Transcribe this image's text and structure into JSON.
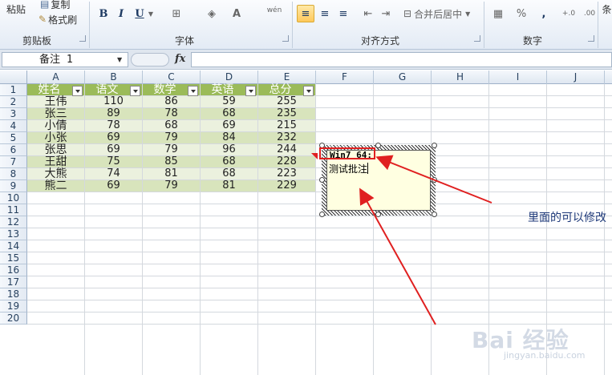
{
  "ribbon": {
    "clipboard": {
      "paste": "粘贴",
      "copy": "复制",
      "format_painter": "格式刷",
      "label": "剪贴板"
    },
    "font": {
      "bold": "B",
      "italic": "I",
      "underline": "U",
      "font_color": "A",
      "wen": "wén",
      "label": "字体"
    },
    "alignment": {
      "merge_center": "合并后居中",
      "label": "对齐方式"
    },
    "number": {
      "percent": "%",
      "comma": ",",
      "label": "数字"
    },
    "cut_off": "条"
  },
  "formula_bar": {
    "name_box": "备注 1",
    "fx": "fx",
    "formula": ""
  },
  "grid": {
    "columns": [
      "A",
      "B",
      "C",
      "D",
      "E",
      "F",
      "G",
      "H",
      "I",
      "J"
    ],
    "rows": [
      "1",
      "2",
      "3",
      "4",
      "5",
      "6",
      "7",
      "8",
      "9",
      "10",
      "11",
      "12",
      "13",
      "14",
      "15",
      "16",
      "17",
      "18",
      "19",
      "20"
    ]
  },
  "table": {
    "headers": [
      "姓名",
      "语文",
      "数学",
      "英语",
      "总分"
    ],
    "rows": [
      [
        "王伟",
        "110",
        "86",
        "59",
        "255"
      ],
      [
        "张三",
        "89",
        "78",
        "68",
        "235"
      ],
      [
        "小倩",
        "78",
        "68",
        "69",
        "215"
      ],
      [
        "小张",
        "69",
        "79",
        "84",
        "232"
      ],
      [
        "张思",
        "69",
        "79",
        "96",
        "244"
      ],
      [
        "王甜",
        "75",
        "85",
        "68",
        "228"
      ],
      [
        "大熊",
        "74",
        "81",
        "68",
        "223"
      ],
      [
        "熊二",
        "69",
        "79",
        "81",
        "229"
      ]
    ]
  },
  "comment": {
    "author": "Win7 64:",
    "text": "测试批注"
  },
  "annotation": {
    "note": "里面的可以修改"
  },
  "watermark": {
    "main": "Bai 经验",
    "sub": "jingyan.baidu.com"
  },
  "colors": {
    "table_header": "#9bbb59",
    "band_a": "#d8e4bc",
    "band_b": "#ebf1de",
    "arrow": "#e02020",
    "note": "#1f3a7a"
  }
}
